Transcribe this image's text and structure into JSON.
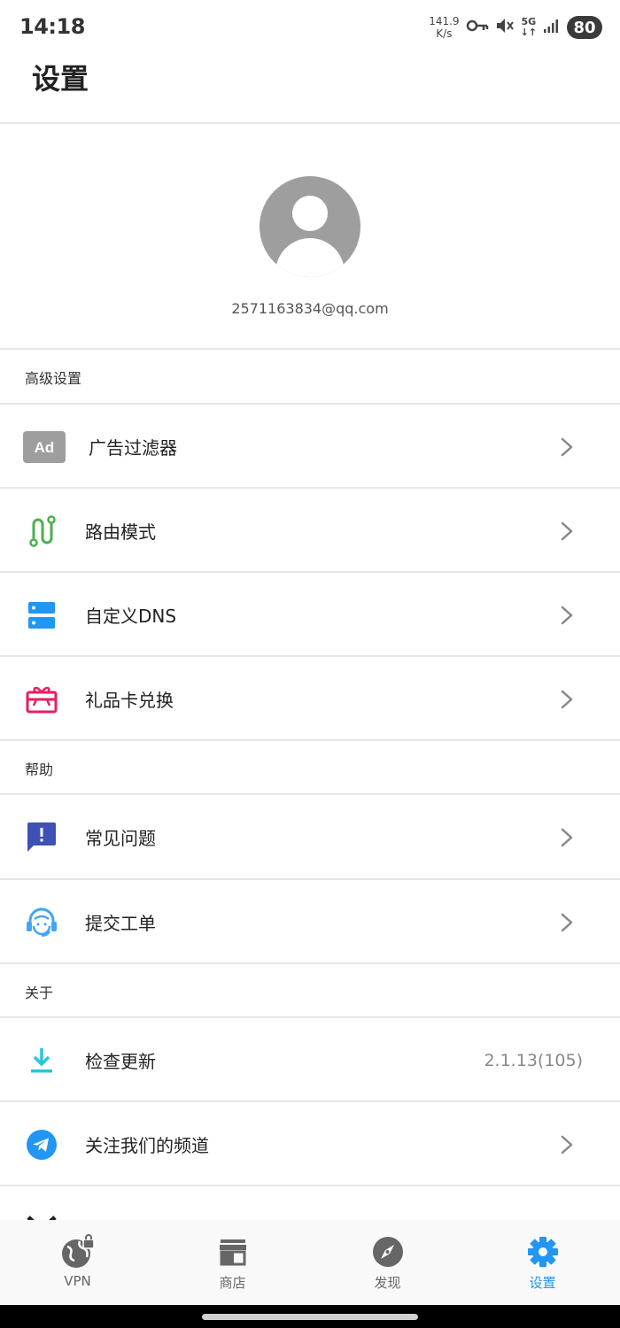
{
  "status_bar": {
    "time": "14:18",
    "net_speed_value": "141.9",
    "net_speed_unit": "K/s",
    "network_type": "5G",
    "battery": "80",
    "icons": [
      "vpn-key-icon",
      "mute-icon",
      "5g-icon",
      "signal-icon",
      "battery-icon"
    ]
  },
  "page": {
    "title": "设置"
  },
  "profile": {
    "email": "2571163834@qq.com",
    "avatar_icon": "avatar-icon"
  },
  "sections": {
    "advanced": "高级设置",
    "help": "帮助",
    "about": "关于"
  },
  "menu": {
    "ad_filter": {
      "label": "广告过滤器",
      "icon": "ad-icon",
      "color": "#9e9e9e",
      "icon_text": "Ad"
    },
    "routing": {
      "label": "路由模式",
      "icon": "route-icon",
      "color": "#4caf50"
    },
    "custom_dns": {
      "label": "自定义DNS",
      "icon": "dns-server-icon",
      "color": "#2196f3"
    },
    "gift_card": {
      "label": "礼品卡兑换",
      "icon": "gift-card-icon",
      "color": "#e91e63"
    },
    "faq": {
      "label": "常见问题",
      "icon": "faq-icon",
      "color": "#3f51b5"
    },
    "ticket": {
      "label": "提交工单",
      "icon": "support-agent-icon",
      "color": "#42a5f5"
    },
    "update": {
      "label": "检查更新",
      "icon": "download-icon",
      "color": "#26c6da",
      "value": "2.1.13(105)"
    },
    "channel": {
      "label": "关注我们的频道",
      "icon": "telegram-icon",
      "color": "#2196f3"
    }
  },
  "bottom_nav": [
    {
      "label": "VPN",
      "icon": "vpn-globe-icon"
    },
    {
      "label": "商店",
      "icon": "store-icon"
    },
    {
      "label": "发现",
      "icon": "compass-icon"
    },
    {
      "label": "设置",
      "icon": "gear-icon",
      "active": true
    }
  ],
  "colors": {
    "accent": "#2196f3",
    "divider": "#e6e6e6",
    "inactive_icon": "#666666"
  }
}
